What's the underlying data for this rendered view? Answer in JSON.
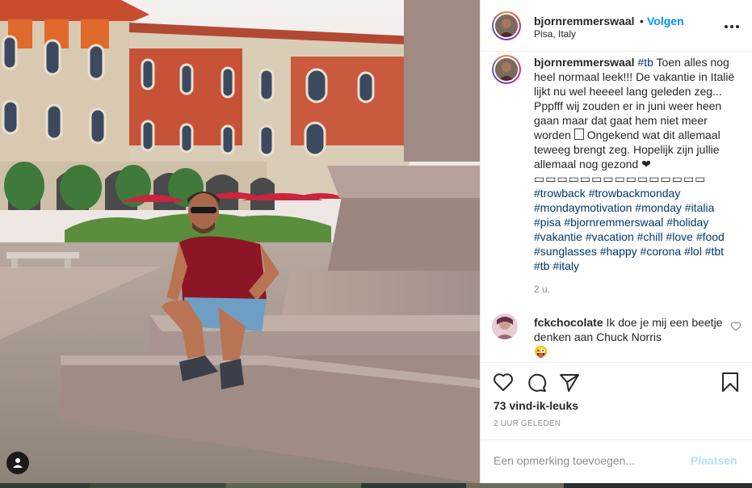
{
  "post": {
    "username": "bjornremmerswaal",
    "follow_dot": "•",
    "follow_label": "Volgen",
    "location": "Pisa, Italy"
  },
  "caption": {
    "username": "bjornremmerswaal",
    "part1": " ",
    "tag_tb": "#tb",
    "part2": " Toen alles nog heel normaal leek!!! De vakantie in Italië lijkt nu wel heeeel lang geleden zeg... Pppfff wij zouden er in juni weer heen gaan maar dat gaat hem niet meer worden ",
    "part3": " Ongekend wat dit allemaal teweeg brengt zeg. Hopelijk zijn jullie allemaal nog gezond ❤",
    "boxes": "▭▭▭▭▭▭▭▭▭▭▭▭▭▭▭",
    "hashtags": [
      "#trowback",
      "#trowbackmonday",
      "#mondaymotivation",
      "#monday",
      "#italia",
      "#pisa",
      "#bjornremmerswaal",
      "#holiday",
      "#vakantie",
      "#vacation",
      "#chill",
      "#love",
      "#food",
      "#sunglasses",
      "#happy",
      "#corona",
      "#lol",
      "#tbt",
      "#tb",
      "#italy"
    ],
    "time_ago": "2 u."
  },
  "comment": {
    "username": "fckchocolate",
    "text": " Ik doe je mij een beetje denken aan Chuck Norris",
    "emoji": "😜"
  },
  "actions": {
    "likes": "73 vind-ik-leuks",
    "posted": "2 UUR GELEDEN"
  },
  "add_comment": {
    "placeholder": "Een opmerking toevoegen...",
    "post_label": "Plaatsen"
  },
  "icons": {
    "like": "heart-icon",
    "comment": "comment-icon",
    "share": "share-icon",
    "save": "bookmark-icon",
    "more": "more-options-icon",
    "tag": "user-tag-icon"
  },
  "colors": {
    "link_blue": "#0095f6",
    "hashtag_blue": "#00376b",
    "muted": "#8e8e8e",
    "post_disabled": "#b2dffc"
  }
}
